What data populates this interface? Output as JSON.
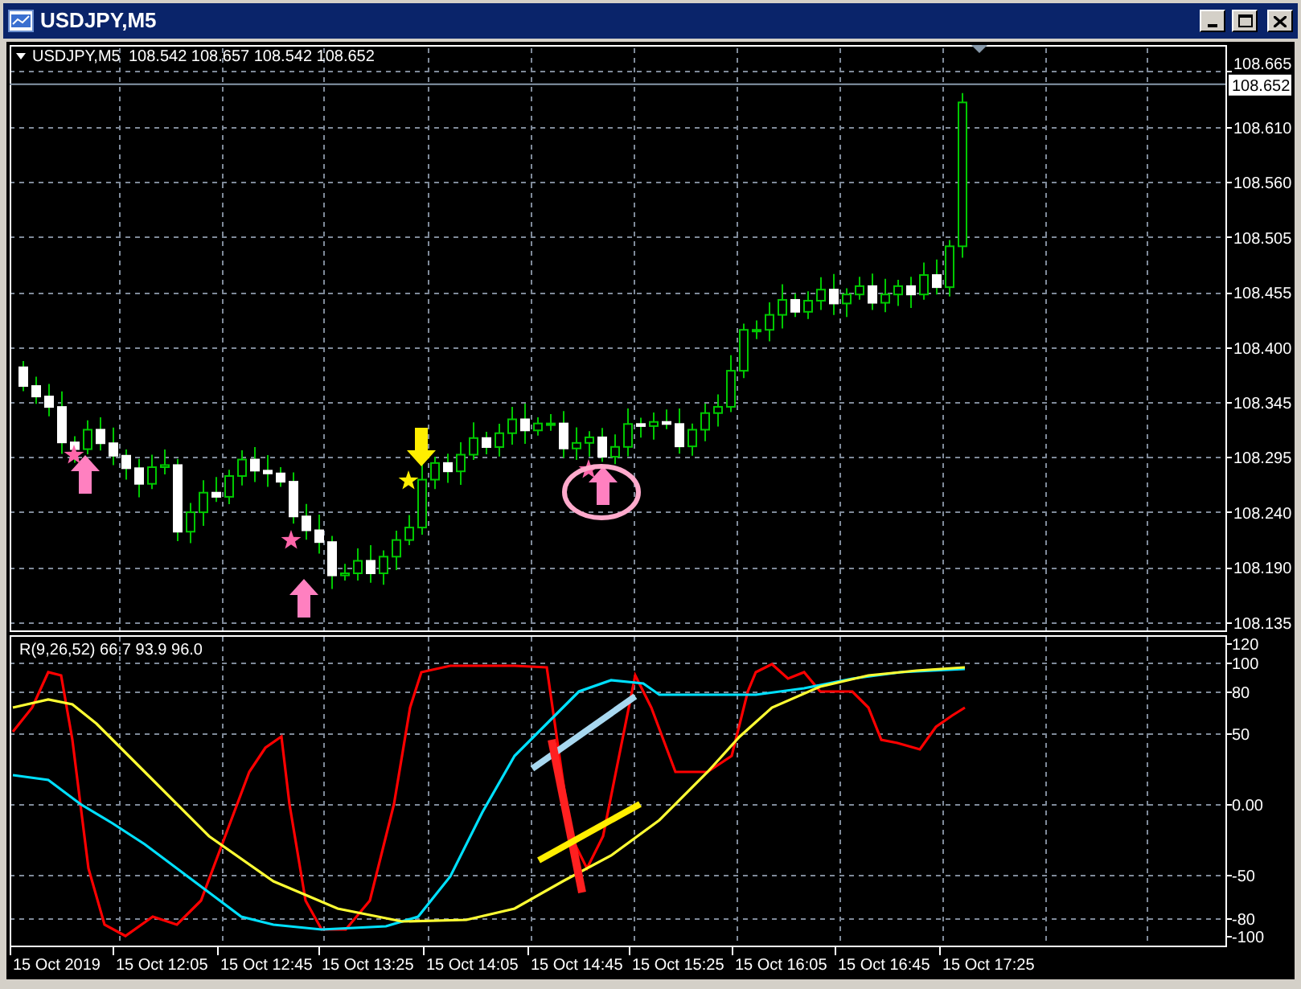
{
  "window": {
    "title": "USDJPY,M5"
  },
  "chart_header": {
    "symbol": "USDJPY,M5",
    "prices": "108.542 108.657 108.542 108.652"
  },
  "price_axis": [
    "108.665",
    "108.610",
    "108.560",
    "108.505",
    "108.455",
    "108.400",
    "108.345",
    "108.295",
    "108.240",
    "108.190",
    "108.135"
  ],
  "current_price": "108.652",
  "indicator": {
    "label": "R(9,26,52) 66.7 93.9 96.0",
    "axis": [
      "120",
      "100",
      "80",
      "50",
      "0.00",
      "-50",
      "-80",
      "-100"
    ]
  },
  "time_axis": [
    "15 Oct 2019",
    "15 Oct 12:05",
    "15 Oct 12:45",
    "15 Oct 13:25",
    "15 Oct 14:05",
    "15 Oct 14:45",
    "15 Oct 15:25",
    "15 Oct 16:05",
    "15 Oct 16:45",
    "15 Oct 17:25"
  ]
}
